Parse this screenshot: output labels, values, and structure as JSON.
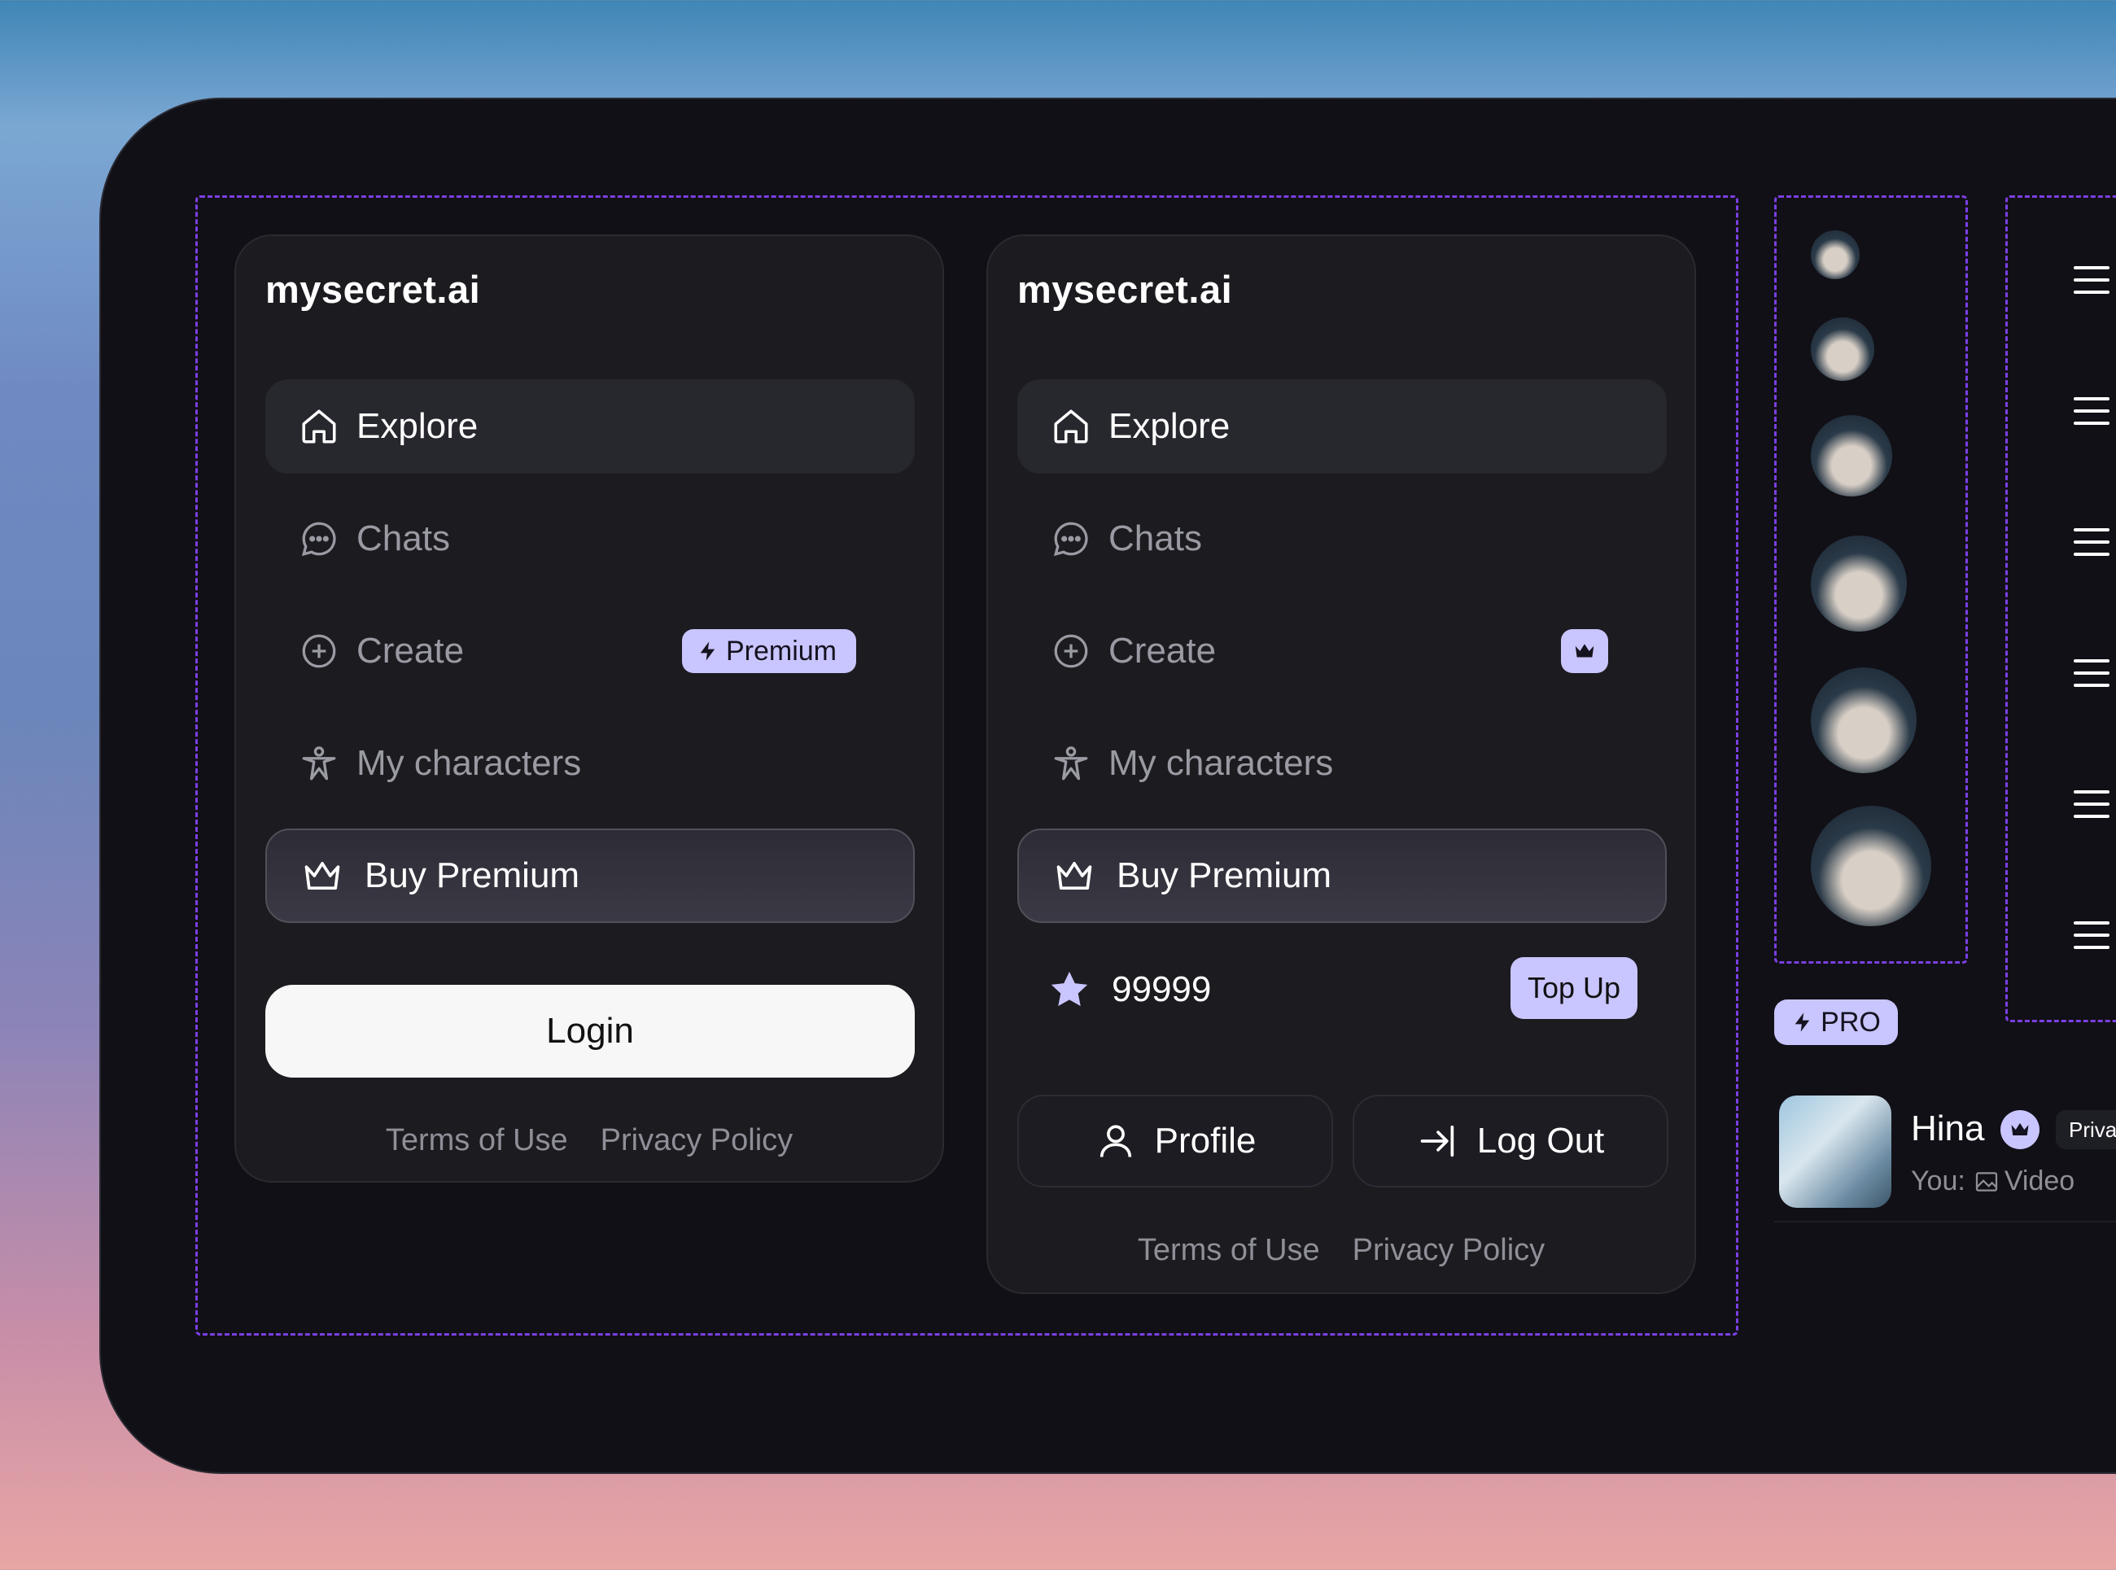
{
  "colors": {
    "accent": "#c9c5ff",
    "dashed": "#7b3fe4",
    "panel": "#1b1b20"
  },
  "panel_left": {
    "brand": "mysecret.ai",
    "nav": [
      {
        "label": "Explore",
        "icon": "home-icon",
        "active": true
      },
      {
        "label": "Chats",
        "icon": "chat-bubble-icon",
        "active": false
      },
      {
        "label": "Create",
        "icon": "plus-circle-icon",
        "active": false
      },
      {
        "label": "My characters",
        "icon": "person-icon",
        "active": false
      }
    ],
    "premium_badge": "Premium",
    "buy_premium": "Buy Premium",
    "login": "Login",
    "terms": "Terms of Use",
    "privacy": "Privacy Policy"
  },
  "panel_right": {
    "brand": "mysecret.ai",
    "nav": [
      {
        "label": "Explore",
        "icon": "home-icon",
        "active": true
      },
      {
        "label": "Chats",
        "icon": "chat-bubble-icon",
        "active": false
      },
      {
        "label": "Create",
        "icon": "plus-circle-icon",
        "active": false
      },
      {
        "label": "My characters",
        "icon": "person-icon",
        "active": false
      }
    ],
    "buy_premium": "Buy Premium",
    "credits": "99999",
    "top_up": "Top Up",
    "profile": "Profile",
    "logout": "Log Out",
    "terms": "Terms of Use",
    "privacy": "Privacy Policy"
  },
  "pro_badge": "PRO",
  "chat_item": {
    "name": "Hina",
    "tag": "Priva",
    "preview_prefix": "You:",
    "preview": "Video"
  }
}
